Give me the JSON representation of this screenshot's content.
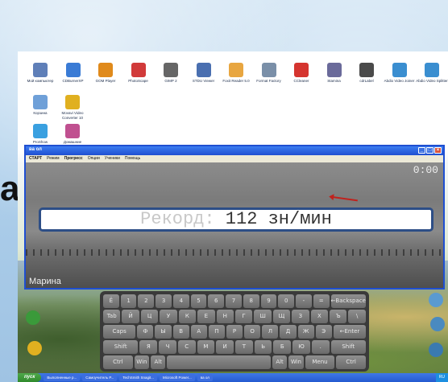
{
  "slide": {
    "left_letter": "a"
  },
  "desktop_icons": [
    {
      "label": "Мой компьютер",
      "color": "#5f7fb8"
    },
    {
      "label": "CDBurnerXP",
      "color": "#3a7bd5"
    },
    {
      "label": "GOM Player",
      "color": "#e08a1b"
    },
    {
      "label": "PhotoScape",
      "color": "#d13a3a"
    },
    {
      "label": "GIMP 2",
      "color": "#666"
    },
    {
      "label": "STDU Viewer",
      "color": "#4a6fb0"
    },
    {
      "label": "Foxit Reader 5.0",
      "color": "#e8a640"
    },
    {
      "label": "Format Factory",
      "color": "#7a8fa8"
    },
    {
      "label": "CCleaner",
      "color": "#d5342f"
    },
    {
      "label": "Stamina",
      "color": "#6a6a9a"
    },
    {
      "label": "cdrLabel",
      "color": "#4a4a4a"
    },
    {
      "label": "Abdio Video Joiner",
      "color": "#3a8ed0"
    },
    {
      "label": "Abdio Video Splitter",
      "color": "#3a8ed0"
    },
    {
      "label": "Корзина",
      "color": "#6fa0d8"
    },
    {
      "label": "Movavi Video Converter 10",
      "color": "#e0b020"
    },
    {
      "label": "ProShow",
      "color": "#3aa0e0"
    },
    {
      "label": "Домашние",
      "color": "#c05090"
    }
  ],
  "window": {
    "title": "ва ол",
    "menu": [
      "СТАРТ",
      "Режим",
      "Прогресс",
      "Опции",
      "Ученики",
      "Помощь"
    ],
    "timer": "0:00",
    "record_label": "Рекорд:",
    "record_value": "112 зн/мин",
    "user": "Марина"
  },
  "keyboard": {
    "rows": [
      [
        "Ё",
        "1",
        "2",
        "3",
        "4",
        "5",
        "6",
        "7",
        "8",
        "9",
        "0",
        "-",
        "=",
        "←Backspace"
      ],
      [
        "Tab",
        "Й",
        "Ц",
        "У",
        "К",
        "Е",
        "Н",
        "Г",
        "Ш",
        "Щ",
        "З",
        "Х",
        "Ъ",
        "\\"
      ],
      [
        "Caps",
        "Ф",
        "Ы",
        "В",
        "А",
        "П",
        "Р",
        "О",
        "Л",
        "Д",
        "Ж",
        "Э",
        "←Enter"
      ],
      [
        "Shift",
        "Я",
        "Ч",
        "С",
        "М",
        "И",
        "Т",
        "Ь",
        "Б",
        "Ю",
        ".",
        "Shift"
      ],
      [
        "Ctrl",
        "Win",
        "Alt",
        "",
        "Alt",
        "Win",
        "Menu",
        "Ctrl"
      ]
    ]
  },
  "taskbar": {
    "start": "пуск",
    "tasks": [
      "Выполненные р...",
      "Самоучитель Р...",
      "TechSmith Snagit...",
      "Microsoft Power...",
      "ва ол"
    ],
    "tray_text": "RU"
  }
}
